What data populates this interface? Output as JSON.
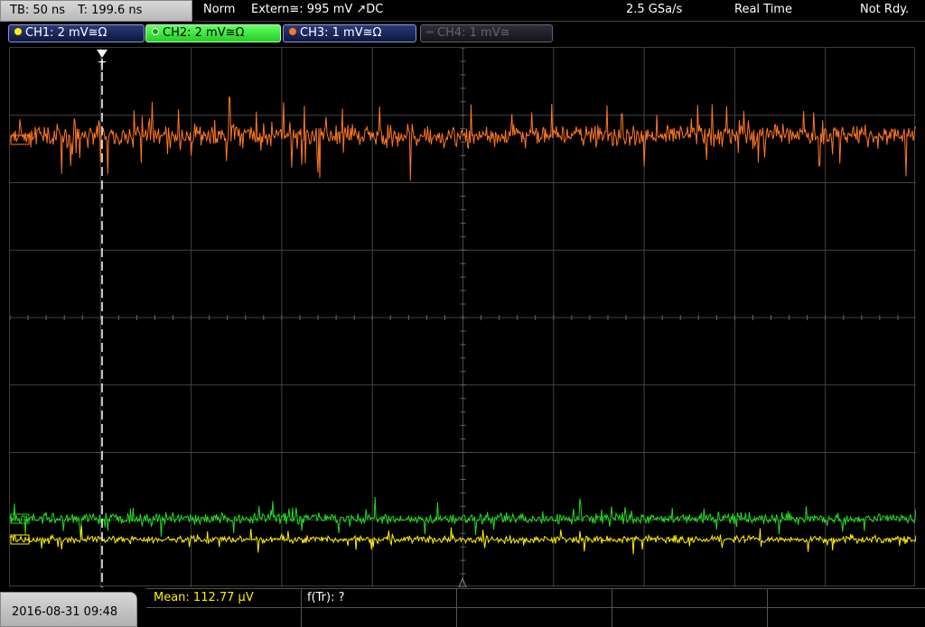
{
  "topbar": {
    "timebase": "TB: 50 ns",
    "trigger_time": "T: 199.6 ns",
    "mode": "Norm",
    "trigger_source": "Extern≅: 995 mV ↗DC",
    "sample_rate": "2.5 GSa/s",
    "acquisition": "Real Time",
    "state": "Not Rdy."
  },
  "channels": [
    {
      "label": "CH1: 2 mV≅Ω",
      "color": "#ffee00",
      "active": true
    },
    {
      "label": "CH2: 2 mV≅Ω",
      "color": "#22dd22",
      "selected": true
    },
    {
      "label": "CH3: 1 mV≅Ω",
      "color": "#ff7722",
      "active": true
    },
    {
      "label": "CH4: 1 mV≅",
      "color": "#555555",
      "active": false
    }
  ],
  "trigger_marker": "T",
  "bottom": {
    "datetime": "2016-08-31 09:48",
    "mean": "Mean: 112.77 µV",
    "freq": "f(Tr): ?"
  },
  "colors": {
    "ch1": "#ffee00",
    "ch2": "#22dd22",
    "ch3": "#ff7722",
    "grid": "#444444"
  },
  "icons": [
    "trigger-position-icon",
    "trigger-level-icon",
    "channel-dot-icon"
  ]
}
